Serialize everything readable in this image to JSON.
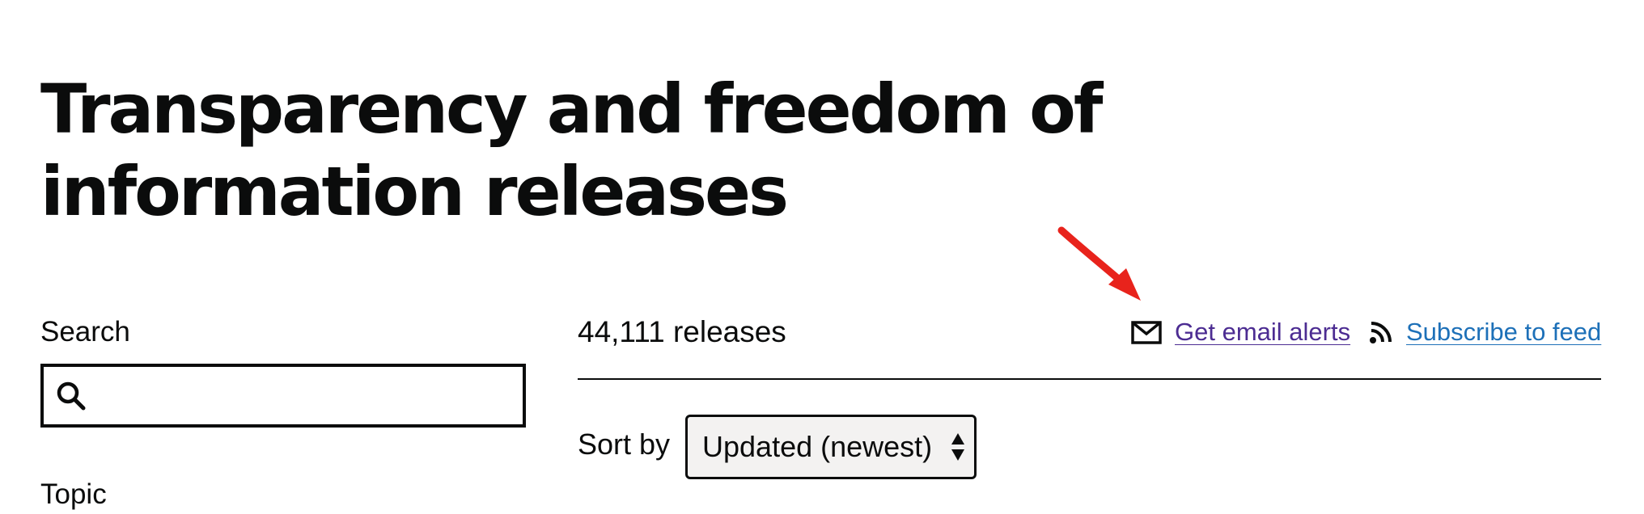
{
  "page": {
    "title": "Transparency and freedom of information releases"
  },
  "filters": {
    "search_label": "Search",
    "search_value": "",
    "search_icon": "search-icon",
    "topic_label": "Topic"
  },
  "results": {
    "count_text": "44,111 releases",
    "email_alerts": {
      "label": "Get email alerts",
      "icon": "envelope-icon",
      "color": "#4c2c92"
    },
    "feed": {
      "label": "Subscribe to feed",
      "icon": "rss-icon",
      "color": "#1d70b8"
    },
    "sort": {
      "label": "Sort by",
      "selected": "Updated (newest)"
    }
  },
  "annotation": {
    "type": "arrow",
    "color": "#e8231c",
    "target": "email-alerts-link"
  }
}
